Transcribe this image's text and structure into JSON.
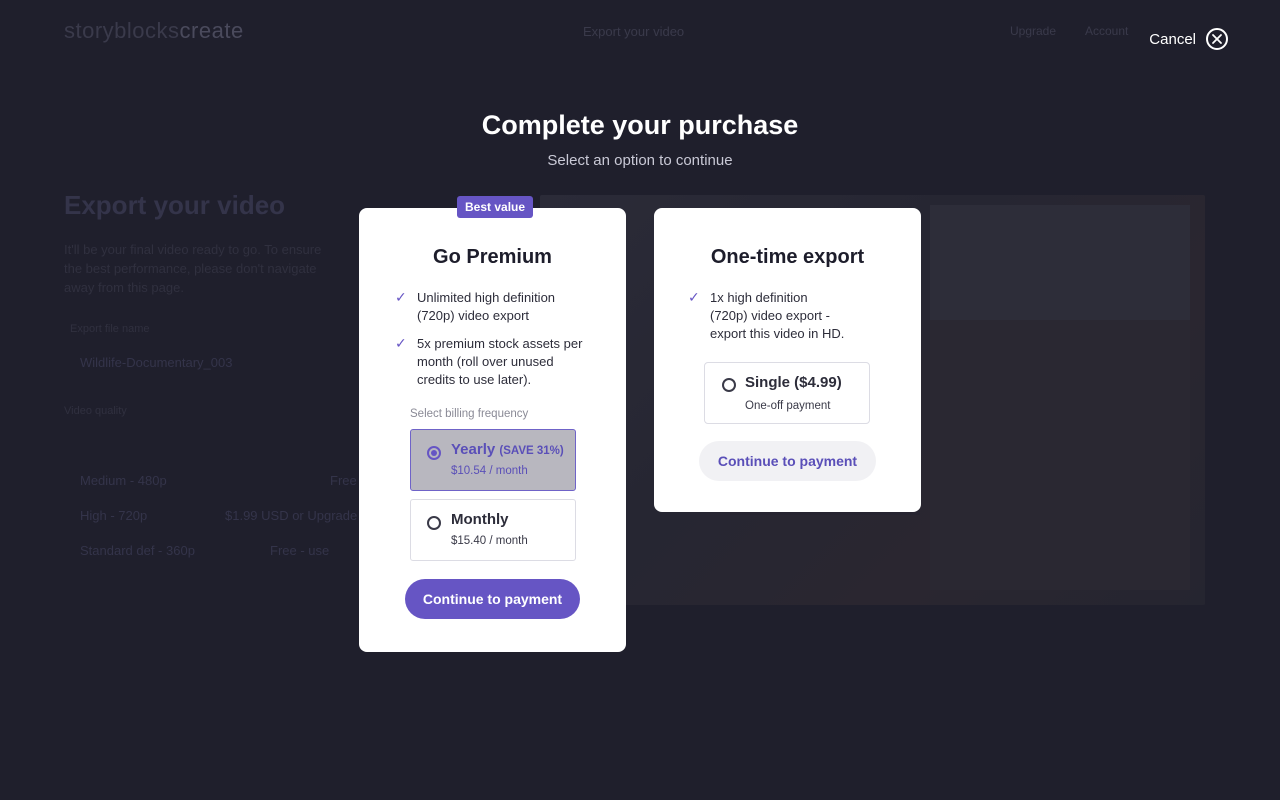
{
  "background": {
    "logo_text_a": "storyblocks",
    "logo_text_b": "create",
    "header_title": "Export your video",
    "upgrade_link": "Upgrade",
    "account_link": "Account",
    "page_title": "Export your video",
    "page_description": "It'll be your final video ready to go. To ensure the best performance, please don't navigate away from this page.",
    "file_name_label": "Export file name",
    "file_name_value": "Wildlife-Documentary_003",
    "quality_label": "Video quality",
    "quality_rows": [
      {
        "name": "Medium - 480p",
        "price": "Free"
      },
      {
        "name": "High - 720p",
        "price": "$1.99 USD or Upgrade"
      },
      {
        "name": "Standard def - 360p",
        "price": "Free - use"
      }
    ]
  },
  "modal": {
    "cancel_label": "Cancel",
    "heading": "Complete your purchase",
    "subheading": "Select an option to continue",
    "premium": {
      "badge": "Best value",
      "title": "Go Premium",
      "features": [
        "Unlimited high definition (720p) video export",
        "5x premium stock assets per month (roll over unused credits to use later)."
      ],
      "billing_label": "Select billing frequency",
      "options": [
        {
          "name": "Yearly",
          "save": "(SAVE 31%)",
          "price": "$10.54 / month",
          "selected": true
        },
        {
          "name": "Monthly",
          "price": "$15.40 / month",
          "selected": false
        }
      ],
      "cta": "Continue to payment"
    },
    "onetime": {
      "title": "One-time export",
      "features": [
        "1x high definition (720p) video export - export this video in HD."
      ],
      "option": {
        "name": "Single ($4.99)",
        "price": "One-off payment",
        "selected": false
      },
      "cta": "Continue to payment"
    }
  },
  "colors": {
    "overlay": "#1f1f2c",
    "accent": "#6655c4",
    "card": "#ffffff"
  }
}
